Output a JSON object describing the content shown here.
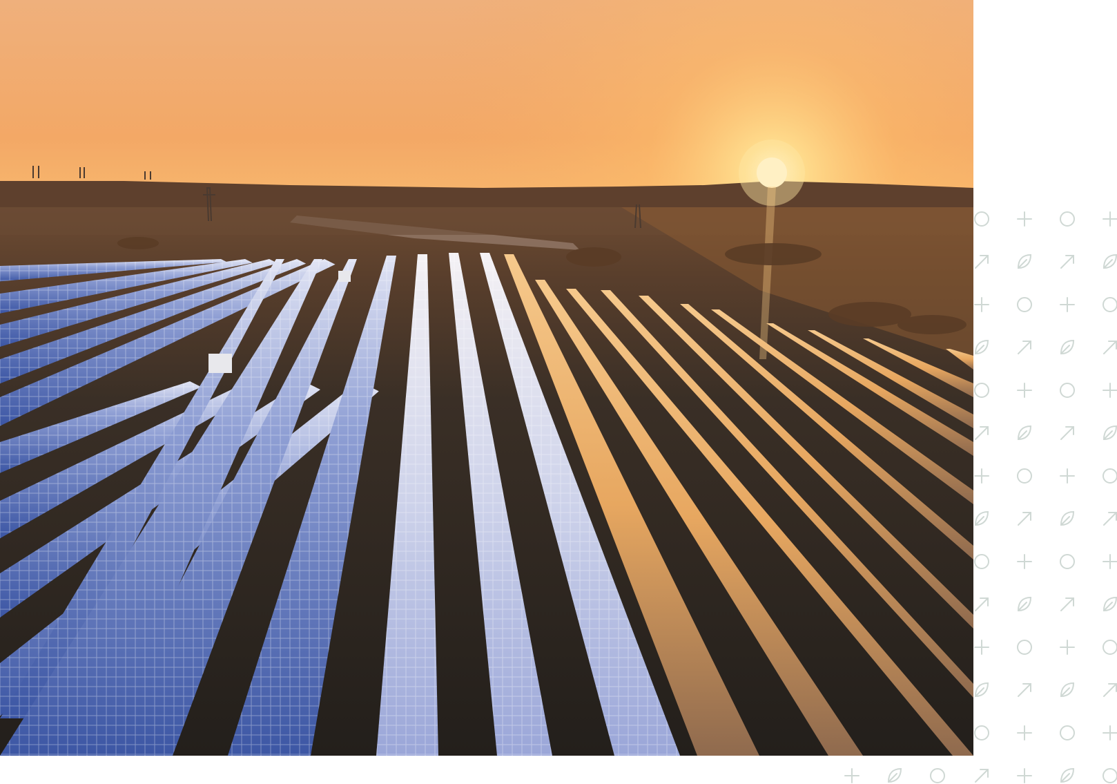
{
  "scene": {
    "subject": "solar-farm-at-sunset",
    "colors": {
      "sky_top": "#f2b27a",
      "sky_mid": "#f0a565",
      "horizon_glow": "#ffd27a",
      "sun": "#fff3c2",
      "ground_far": "#6b4a33",
      "ground_near": "#2b2620",
      "panel_blue": "#3d5aa8",
      "panel_light": "#c9d2ee",
      "panel_gold": "#f0b36a",
      "pattern_icon": "#cfd8d4"
    }
  },
  "pattern": {
    "icon_sequence": [
      "circle-icon",
      "leaf-icon",
      "plus-icon",
      "arrow-icon"
    ]
  }
}
